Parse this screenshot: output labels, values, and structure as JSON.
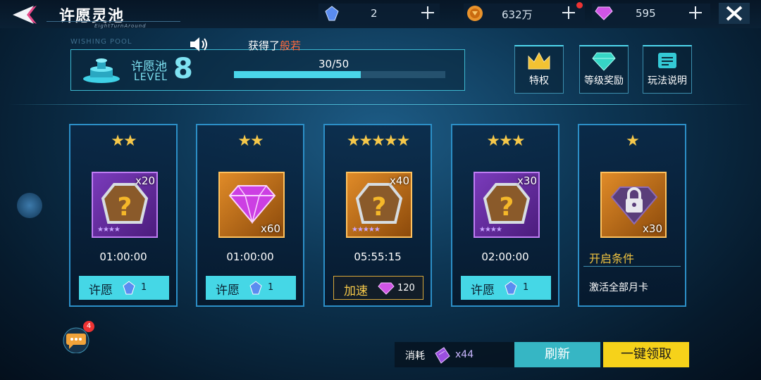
{
  "header": {
    "title": "许愿灵池",
    "subtitle": "EightTurnAround",
    "resources": [
      {
        "icon": "blue-crystal-icon",
        "value": "2"
      },
      {
        "icon": "gold-coin-icon",
        "value": "632万"
      },
      {
        "icon": "purple-diamond-icon",
        "value": "595"
      }
    ]
  },
  "pool": {
    "bg_label": "WISHING POOL",
    "name": "许愿池",
    "level_label": "LEVEL",
    "level": "8",
    "progress_text": "30/50",
    "progress_fraction": 0.6,
    "notice_prefix": "获得了",
    "notice_highlight": "般若"
  },
  "top_buttons": [
    {
      "label": "特权",
      "icon": "crown-icon"
    },
    {
      "label": "等级奖励",
      "icon": "diamond-icon"
    },
    {
      "label": "玩法说明",
      "icon": "document-icon"
    }
  ],
  "cards": [
    {
      "stars": "★★",
      "item_style": "purple",
      "qty": "x20",
      "timer": "01:00:00",
      "action_label": "许愿",
      "action_cost": "1"
    },
    {
      "stars": "★★",
      "item_style": "orange",
      "qty": "x60",
      "timer": "01:00:00",
      "action_label": "许愿",
      "action_cost": "1"
    },
    {
      "stars": "★★★★★",
      "item_style": "orange",
      "qty": "x40",
      "timer": "05:55:15",
      "action_label": "加速",
      "action_cost": "120"
    },
    {
      "stars": "★★★",
      "item_style": "purple",
      "qty": "x30",
      "timer": "02:00:00",
      "action_label": "许愿",
      "action_cost": "1"
    },
    {
      "stars": "★",
      "item_style": "orange",
      "qty": "x30",
      "cond_title": "开启条件",
      "cond_text": "激活全部月卡"
    }
  ],
  "bottom": {
    "chat_badge": "4",
    "cost_label": "消耗",
    "cost_value": "x44",
    "refresh_label": "刷新",
    "claim_label": "一键领取"
  },
  "colors": {
    "accent": "#45d7e6",
    "gold": "#f6c84a",
    "claim": "#f6d21a",
    "refresh": "#36b6c4"
  }
}
